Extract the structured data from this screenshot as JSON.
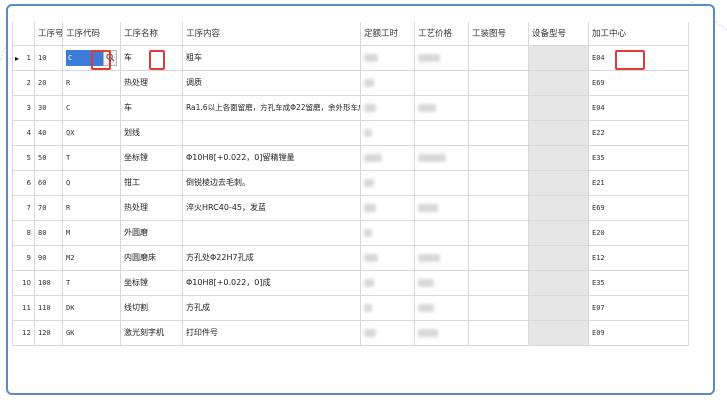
{
  "columns": [
    "工序号",
    "工序代码",
    "工序名称",
    "工序内容",
    "定额工时",
    "工艺价格",
    "工装图号",
    "设备型号",
    "加工中心"
  ],
  "rows": [
    {
      "num": "1",
      "seq": "10",
      "code": "C",
      "name": "车",
      "content": "粗车",
      "center": "E04"
    },
    {
      "num": "2",
      "seq": "20",
      "code": "R",
      "name": "热处理",
      "content": "调质",
      "center": "E69"
    },
    {
      "num": "3",
      "seq": "30",
      "code": "C",
      "name": "车",
      "content": "Ra1.6以上各面留磨，方孔车成Φ22留磨，余外形车成",
      "center": "E04"
    },
    {
      "num": "4",
      "seq": "40",
      "code": "QX",
      "name": "划线",
      "content": "",
      "center": "E22"
    },
    {
      "num": "5",
      "seq": "50",
      "code": "T",
      "name": "坐标镗",
      "content": "Φ10H8[+0.022，0]留精镗量",
      "center": "E35"
    },
    {
      "num": "6",
      "seq": "60",
      "code": "Q",
      "name": "钳工",
      "content": "倒锐棱边去毛刺。",
      "center": "E21"
    },
    {
      "num": "7",
      "seq": "70",
      "code": "R",
      "name": "热处理",
      "content": "淬火HRC40-45，发蓝",
      "center": "E69"
    },
    {
      "num": "8",
      "seq": "80",
      "code": "M",
      "name": "外圆磨",
      "content": "",
      "center": "E20"
    },
    {
      "num": "9",
      "seq": "90",
      "code": "M2",
      "name": "内圆磨床",
      "content": "方孔处Φ22H7孔成",
      "center": "E12"
    },
    {
      "num": "10",
      "seq": "100",
      "code": "T",
      "name": "坐标镗",
      "content": "Φ10H8[+0.022，0]成",
      "center": "E35"
    },
    {
      "num": "11",
      "seq": "110",
      "code": "DK",
      "name": "线切割",
      "content": "方孔成",
      "center": "E07"
    },
    {
      "num": "12",
      "seq": "120",
      "code": "GK",
      "name": "激光刻字机",
      "content": "打印件号",
      "center": "E09"
    }
  ],
  "colors": {
    "frame": "#5b8bc6",
    "selection": "#3d7bd9",
    "highlight": "#e53935",
    "grayCol": "#e6e6e6"
  },
  "icons": {
    "lookup": "search-icon",
    "current_row": "row-pointer-icon"
  }
}
